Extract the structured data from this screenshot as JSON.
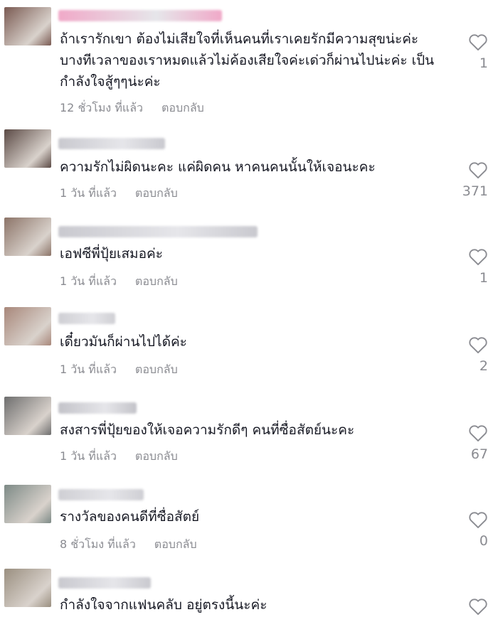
{
  "comments": [
    {
      "text": "ถ้าเรารักเขา ต้องไม่เสียใจที่เห็นคนที่เราเคยรักมีความสุขน่ะค่ะ บางทีเวลาของเราหมดแล้วไม่ค้องเสียใจค่ะเด่วก็ผ่านไปน่ะค่ะ เป็นกำลังใจสู้ๆๆน่ะค่ะ",
      "time": "12 ชั่วโมง ที่แล้ว",
      "reply": "ตอบกลับ",
      "likes": "1",
      "avatar_color": "#7a5a52",
      "username_color": "#f0a9c8"
    },
    {
      "text": "ความรักไม่ผิดนะคะ แค่ผิดคน หาคนคนนั้นให้เจอนะคะ",
      "time": "1 วัน ที่แล้ว",
      "reply": "ตอบกลับ",
      "likes": "371",
      "avatar_color": "#5b4a45",
      "username_color": "#c9c9cf"
    },
    {
      "text": "เอฟซีพี่ปุ้ยเสมอค่ะ",
      "time": "1 วัน ที่แล้ว",
      "reply": "ตอบกลับ",
      "likes": "1",
      "avatar_color": "#8c7468",
      "username_color": "#c9c9cf"
    },
    {
      "text": "เดี๋ยวมันก็ผ่านไปได้ค่ะ",
      "time": "1 วัน ที่แล้ว",
      "reply": "ตอบกลับ",
      "likes": "2",
      "avatar_color": "#a8877a",
      "username_color": "#cfcfd4"
    },
    {
      "text": "สงสารพี่ปุ้ยของให้เจอความรักดีๆ คนที่ซื่อสัตย์นะคะ",
      "time": "1 วัน ที่แล้ว",
      "reply": "ตอบกลับ",
      "likes": "67",
      "avatar_color": "#6e6e6e",
      "username_color": "#c3c3c9"
    },
    {
      "text": "รางวัลของคนดีที่ซื่อสัตย์",
      "time": "8 ชั่วโมง ที่แล้ว",
      "reply": "ตอบกลับ",
      "likes": "0",
      "avatar_color": "#7d8a86",
      "username_color": "#cfcfd4"
    },
    {
      "text": "กำลังใจจากแฟนคลับ อยู่ตรงนี้นะค่ะ",
      "time": "",
      "reply": "",
      "likes": "",
      "avatar_color": "#9a8f80",
      "username_color": "#c9c9cf"
    }
  ]
}
